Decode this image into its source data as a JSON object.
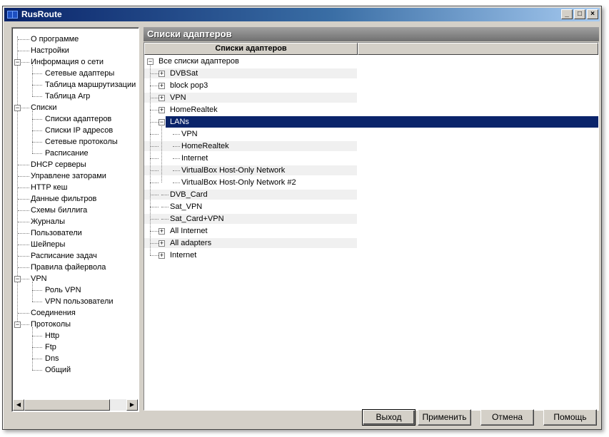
{
  "window": {
    "title": "RusRoute",
    "minimize_glyph": "_",
    "maximize_glyph": "□",
    "close_glyph": "×"
  },
  "sidebar": {
    "items": [
      {
        "label": "О программе",
        "level": 1
      },
      {
        "label": "Настройки",
        "level": 1
      },
      {
        "label": "Информация о сети",
        "level": 1,
        "expandable": true
      },
      {
        "label": "Сетевые адаптеры",
        "level": 2
      },
      {
        "label": "Таблица маршрутизации",
        "level": 2
      },
      {
        "label": "Таблица Arp",
        "level": 2
      },
      {
        "label": "Списки",
        "level": 1,
        "expandable": true
      },
      {
        "label": "Списки адаптеров",
        "level": 2
      },
      {
        "label": "Списки IP адресов",
        "level": 2
      },
      {
        "label": "Сетевые протоколы",
        "level": 2
      },
      {
        "label": "Расписание",
        "level": 2
      },
      {
        "label": "DHCP серверы",
        "level": 1
      },
      {
        "label": "Управлене заторами",
        "level": 1
      },
      {
        "label": "HTTP кеш",
        "level": 1
      },
      {
        "label": "Данные фильтров",
        "level": 1
      },
      {
        "label": "Схемы биллига",
        "level": 1
      },
      {
        "label": "Журналы",
        "level": 1
      },
      {
        "label": "Пользователи",
        "level": 1
      },
      {
        "label": "Шейперы",
        "level": 1
      },
      {
        "label": "Расписание задач",
        "level": 1
      },
      {
        "label": "Правила файервола",
        "level": 1
      },
      {
        "label": "VPN",
        "level": 1,
        "expandable": true
      },
      {
        "label": "Роль VPN",
        "level": 2
      },
      {
        "label": "VPN пользователи",
        "level": 2
      },
      {
        "label": "Соединения",
        "level": 1
      },
      {
        "label": "Протоколы",
        "level": 1,
        "expandable": true
      },
      {
        "label": "Http",
        "level": 2
      },
      {
        "label": "Ftp",
        "level": 2
      },
      {
        "label": "Dns",
        "level": 2
      },
      {
        "label": "Общий",
        "level": 2
      }
    ]
  },
  "panel": {
    "title": "Списки адаптеров",
    "column_header": "Списки адаптеров"
  },
  "list": {
    "rows": [
      {
        "label": "Все списки адаптеров",
        "level": 0,
        "expander": "-"
      },
      {
        "label": "DVBSat",
        "level": 1,
        "expander": "+"
      },
      {
        "label": "block pop3",
        "level": 1,
        "expander": "+"
      },
      {
        "label": "VPN",
        "level": 1,
        "expander": "+"
      },
      {
        "label": "HomeRealtek",
        "level": 1,
        "expander": "+"
      },
      {
        "label": "LANs",
        "level": 1,
        "expander": "-",
        "selected": true
      },
      {
        "label": "VPN",
        "level": 2
      },
      {
        "label": "HomeRealtek",
        "level": 2
      },
      {
        "label": "Internet",
        "level": 2
      },
      {
        "label": "VirtualBox Host-Only Network",
        "level": 2
      },
      {
        "label": "VirtualBox Host-Only Network #2",
        "level": 2
      },
      {
        "label": "DVB_Card",
        "level": 1
      },
      {
        "label": "Sat_VPN",
        "level": 1
      },
      {
        "label": "Sat_Card+VPN",
        "level": 1
      },
      {
        "label": "All Internet",
        "level": 1,
        "expander": "+"
      },
      {
        "label": "All adapters",
        "level": 1,
        "expander": "+"
      },
      {
        "label": "Internet",
        "level": 1,
        "expander": "+"
      }
    ]
  },
  "buttons": {
    "exit": "Выход",
    "apply": "Применить",
    "cancel": "Отмена",
    "help": "Помощь"
  },
  "colors": {
    "selection": "#0a246a",
    "titlebar": "#0a246a",
    "panel_header": "#808080"
  }
}
